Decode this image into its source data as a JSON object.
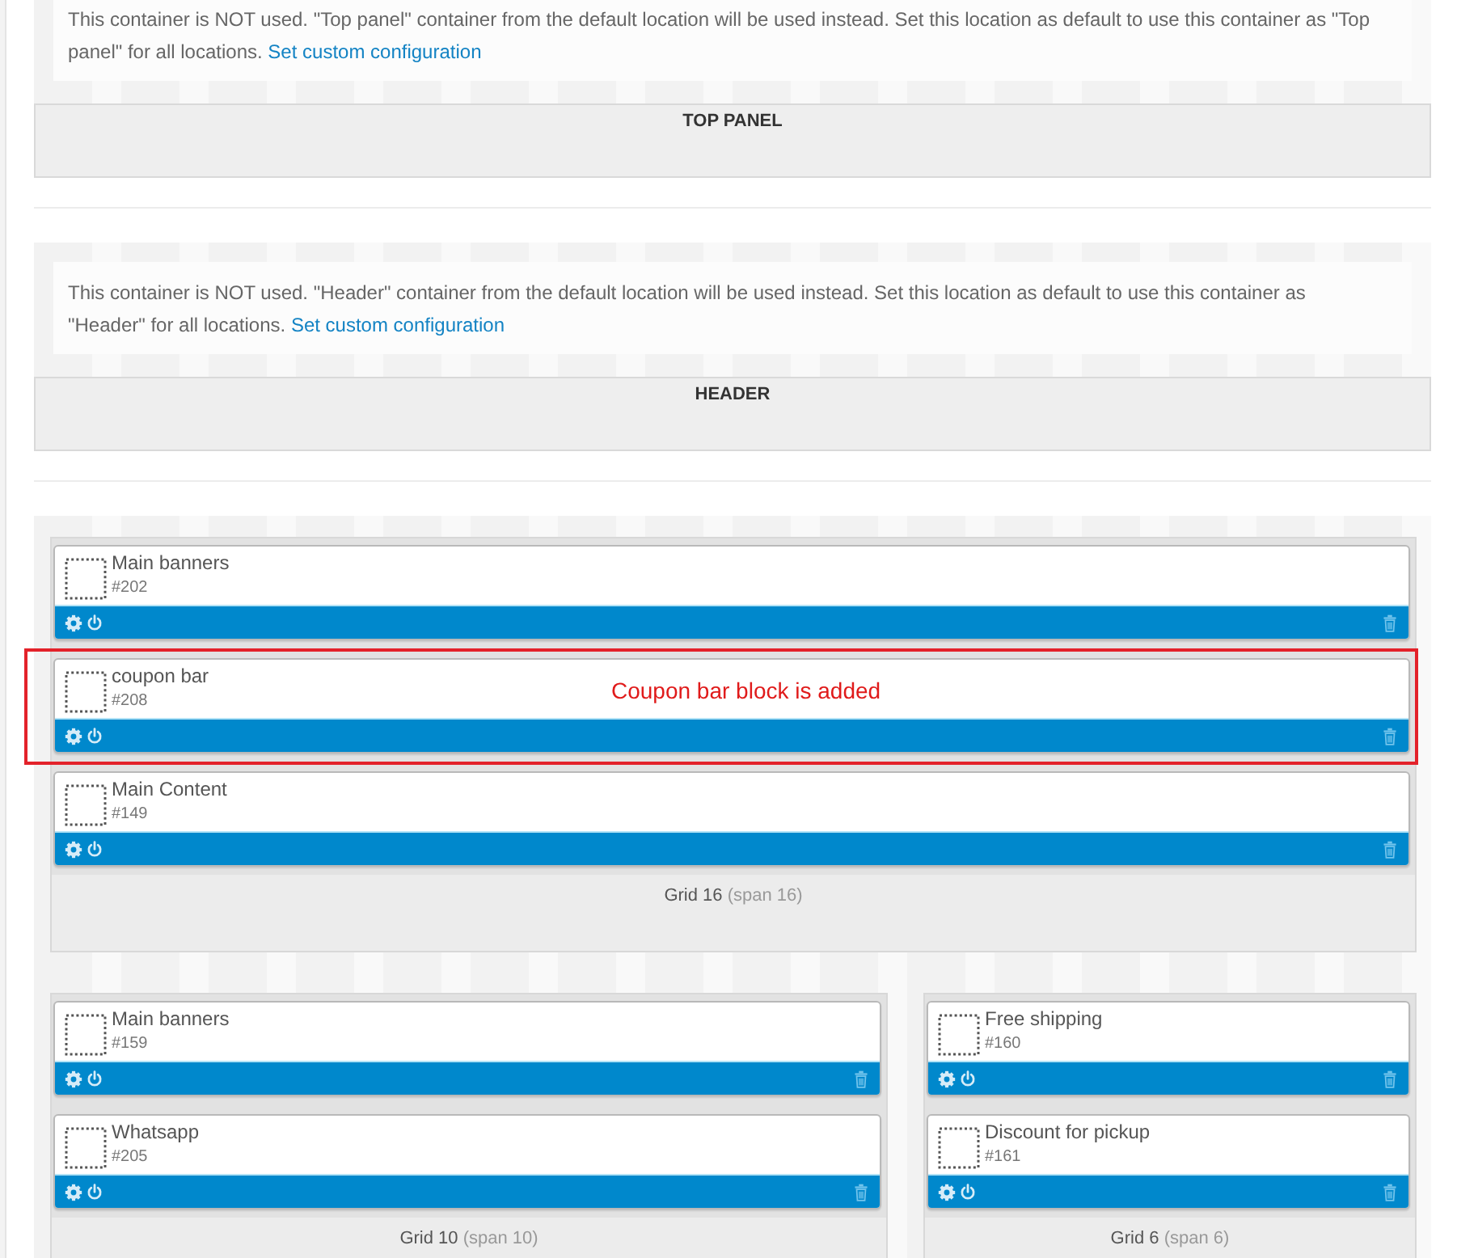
{
  "containers": [
    {
      "notice": {
        "text": "This container is NOT used. \"Top panel\" container from the default location will be used instead. Set this location as default to use this container as \"Top panel\" for all locations.",
        "link": "Set custom configuration"
      },
      "title": "TOP PANEL"
    },
    {
      "notice": {
        "text": "This container is NOT used. \"Header\" container from the default location will be used instead. Set this location as default to use this container as \"Header\" for all locations.",
        "link": "Set custom configuration"
      },
      "title": "HEADER"
    }
  ],
  "layout": {
    "rows": [
      {
        "grids": [
          {
            "title": "Grid 16",
            "span": "(span 16)",
            "blocks": [
              {
                "name": "Main banners",
                "id": "#202"
              },
              {
                "name": "coupon bar",
                "id": "#208",
                "annotation": "Coupon bar block is added"
              },
              {
                "name": "Main Content",
                "id": "#149"
              }
            ]
          }
        ]
      },
      {
        "grids": [
          {
            "title": "Grid 10",
            "span": "(span 10)",
            "blocks": [
              {
                "name": "Main banners",
                "id": "#159"
              },
              {
                "name": "Whatsapp",
                "id": "#205"
              }
            ]
          },
          {
            "title": "Grid 6",
            "span": "(span 6)",
            "blocks": [
              {
                "name": "Free shipping",
                "id": "#160"
              },
              {
                "name": "Discount for pickup",
                "id": "#161"
              }
            ]
          }
        ]
      }
    ]
  }
}
